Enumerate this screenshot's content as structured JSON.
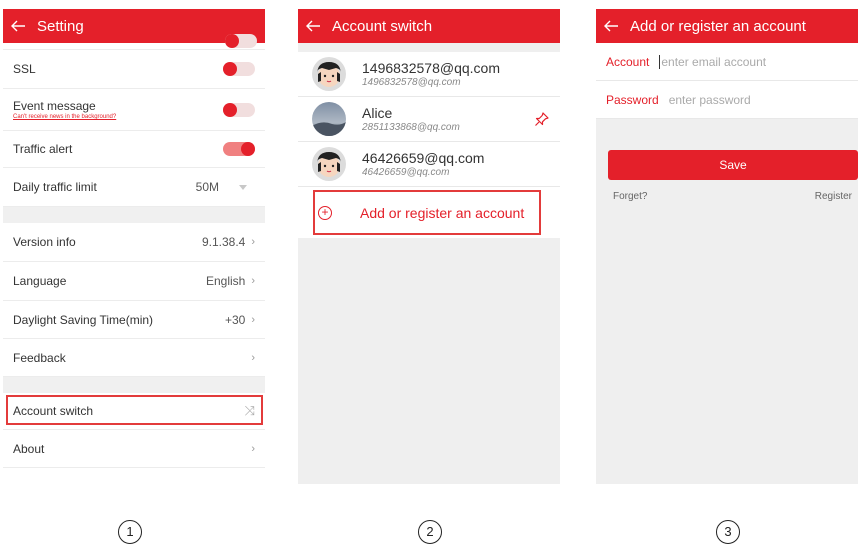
{
  "panel1": {
    "title": "Setting",
    "rows": {
      "ssl": {
        "label": "SSL"
      },
      "event": {
        "label": "Event message",
        "sub": "Can't receive news in the background?"
      },
      "traffic_alert": {
        "label": "Traffic alert"
      },
      "daily_limit": {
        "label": "Daily traffic limit",
        "value": "50M"
      },
      "version": {
        "label": "Version info",
        "value": "9.1.38.4"
      },
      "language": {
        "label": "Language",
        "value": "English"
      },
      "daylight": {
        "label": "Daylight Saving Time(min)",
        "value": "+30"
      },
      "feedback": {
        "label": "Feedback"
      },
      "account_switch": {
        "label": "Account switch",
        "icon": "shuffle-icon"
      },
      "about": {
        "label": "About"
      }
    },
    "chevron": "›",
    "step": "①"
  },
  "panel2": {
    "title": "Account switch",
    "accounts": [
      {
        "name": "1496832578@qq.com",
        "id": "1496832578@qq.com",
        "avatar": "cartoon-avatar"
      },
      {
        "name": "Alice",
        "id": "2851133868@qq.com",
        "avatar": "photo-avatar",
        "pinned": true
      },
      {
        "name": "46426659@qq.com",
        "id": "46426659@qq.com",
        "avatar": "cartoon-avatar"
      }
    ],
    "add_label": "Add or register an account",
    "add_icon": "+",
    "step": "②"
  },
  "panel3": {
    "title": "Add or register an account",
    "account_label": "Account",
    "account_placeholder": "enter email account",
    "password_label": "Password",
    "password_placeholder": "enter password",
    "save_label": "Save",
    "forget_label": "Forget?",
    "register_label": "Register",
    "step": "③"
  },
  "colors": {
    "accent": "#e4202a",
    "highlight": "#e33b3b",
    "background": "#efefef"
  }
}
